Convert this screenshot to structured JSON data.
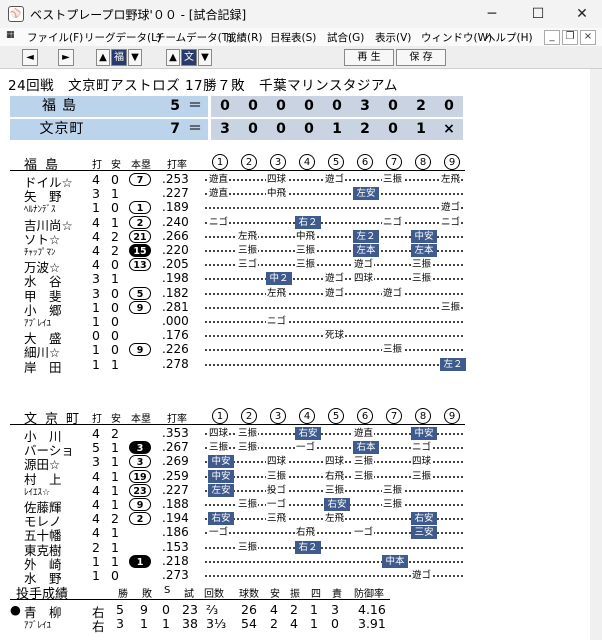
{
  "window": {
    "title": "ベストプレープロ野球'００ - [試合記録]",
    "minimize": "─",
    "maximize": "☐",
    "close": "✕"
  },
  "menu": [
    "ファイル(F)",
    "リーグデータ(L)",
    "チームデータ(T)",
    "成績(R)",
    "日程表(S)",
    "試合(G)",
    "表示(V)",
    "ウィンドウ(W)",
    "ヘルプ(H)"
  ],
  "mdi": {
    "min": "_",
    "restore": "❐",
    "close": "×"
  },
  "toolbar": {
    "prev": "◄",
    "next": "►",
    "up1": "▲",
    "fuku": "福",
    "down1": "▼",
    "up2": "▲",
    "bun": "文",
    "down2": "▼",
    "play": "再 生",
    "save": "保 存"
  },
  "game": {
    "title": "24回戦　文京町アストロズ 17勝７敗　千葉マリンスタジアム",
    "teams": [
      {
        "name": "福島",
        "runs": "5",
        "eq": "＝",
        "innings": [
          "0",
          "0",
          "0",
          "0",
          "0",
          "3",
          "0",
          "2",
          "0"
        ]
      },
      {
        "name": "文京町",
        "runs": "7",
        "eq": "＝",
        "innings": [
          "3",
          "0",
          "0",
          "0",
          "1",
          "2",
          "0",
          "1",
          "×"
        ]
      }
    ]
  },
  "headers": {
    "hits_label": "打",
    "an": "安",
    "hr": "本塁",
    "avg": "打率",
    "innings": [
      "1",
      "2",
      "3",
      "4",
      "5",
      "6",
      "7",
      "8",
      "9"
    ]
  },
  "team1": {
    "name": "福島",
    "players": [
      {
        "name": "ドイル☆",
        "ab": "4",
        "h": "0",
        "hr": "7",
        "avg": ".253",
        "r": [
          [
            "遊直",
            0,
            false
          ],
          [
            "四球",
            2,
            false
          ],
          [
            "遊ゴ",
            4,
            false
          ],
          [
            "三振",
            6,
            false
          ],
          [
            "左飛",
            8,
            false
          ]
        ]
      },
      {
        "name": "矢　野",
        "ab": "3",
        "h": "1",
        "hr": "",
        "avg": ".227",
        "r": [
          [
            "遊直",
            0,
            false
          ],
          [
            "中飛",
            2,
            false
          ],
          [
            "左安",
            5,
            true
          ]
        ]
      },
      {
        "name": "ﾍﾙﾅﾝﾃﾞｽ",
        "small": true,
        "ab": "1",
        "h": "0",
        "hr": "1",
        "avg": ".189",
        "r": [
          [
            "遊ゴ",
            8,
            false
          ]
        ]
      },
      {
        "name": "吉川尚☆",
        "ab": "4",
        "h": "1",
        "hr": "2",
        "avg": ".240",
        "r": [
          [
            "ニゴ",
            0,
            false
          ],
          [
            "右２",
            3,
            true
          ],
          [
            "ニゴ",
            6,
            false
          ],
          [
            "ニゴ",
            8,
            false
          ]
        ]
      },
      {
        "name": "ソト☆",
        "ab": "4",
        "h": "2",
        "hr": "21",
        "avg": ".266",
        "r": [
          [
            "左飛",
            1,
            false
          ],
          [
            "中飛",
            3,
            false
          ],
          [
            "左２",
            5,
            true
          ],
          [
            "中安",
            7,
            true
          ]
        ]
      },
      {
        "name": "ﾁｬｯﾌﾟﾏﾝ",
        "small": true,
        "ab": "4",
        "h": "2",
        "hr": "15",
        "fill": true,
        "avg": ".220",
        "r": [
          [
            "三振",
            1,
            false
          ],
          [
            "三振",
            3,
            false
          ],
          [
            "左本",
            5,
            true
          ],
          [
            "左本",
            7,
            true
          ]
        ]
      },
      {
        "name": "万波☆",
        "ab": "4",
        "h": "0",
        "hr": "13",
        "avg": ".205",
        "r": [
          [
            "三ゴ",
            1,
            false
          ],
          [
            "三振",
            3,
            false
          ],
          [
            "遊ゴ",
            5,
            false
          ],
          [
            "三振",
            7,
            false
          ]
        ]
      },
      {
        "name": "水　谷",
        "ab": "3",
        "h": "1",
        "hr": "",
        "avg": ".198",
        "r": [
          [
            "中２",
            2,
            true
          ],
          [
            "遊ゴ",
            4,
            false
          ],
          [
            "四球",
            5,
            false
          ],
          [
            "三振",
            7,
            false
          ]
        ]
      },
      {
        "name": "甲　斐",
        "ab": "3",
        "h": "0",
        "hr": "5",
        "avg": ".182",
        "r": [
          [
            "左飛",
            2,
            false
          ],
          [
            "遊ゴ",
            4,
            false
          ],
          [
            "遊ゴ",
            6,
            false
          ]
        ]
      },
      {
        "name": "小　郷",
        "ab": "1",
        "h": "0",
        "hr": "9",
        "avg": ".281",
        "r": [
          [
            "三振",
            8,
            false
          ]
        ]
      },
      {
        "name": "ｱﾌﾞﾚｲﾕ",
        "small": true,
        "ab": "1",
        "h": "0",
        "hr": "",
        "avg": ".000",
        "r": [
          [
            "ニゴ",
            2,
            false
          ]
        ]
      },
      {
        "name": "大　盛",
        "ab": "0",
        "h": "0",
        "hr": "",
        "avg": ".176",
        "r": [
          [
            "死球",
            4,
            false
          ]
        ]
      },
      {
        "name": "細川☆",
        "ab": "1",
        "h": "0",
        "hr": "9",
        "avg": ".226",
        "r": [
          [
            "三振",
            6,
            false
          ]
        ]
      },
      {
        "name": "岸　田",
        "ab": "1",
        "h": "1",
        "hr": "",
        "avg": ".278",
        "r": [
          [
            "左２",
            8,
            true
          ]
        ]
      }
    ]
  },
  "team2": {
    "name": "文京町",
    "players": [
      {
        "name": "小　川",
        "ab": "4",
        "h": "2",
        "hr": "",
        "avg": ".353",
        "r": [
          [
            "四球",
            0,
            false
          ],
          [
            "三振",
            1,
            false
          ],
          [
            "右安",
            3,
            true
          ],
          [
            "遊直",
            5,
            false
          ],
          [
            "中安",
            7,
            true
          ]
        ]
      },
      {
        "name": "バーショ",
        "ab": "5",
        "h": "1",
        "hr": "3",
        "fill": true,
        "avg": ".267",
        "r": [
          [
            "三振",
            0,
            false
          ],
          [
            "三振",
            1,
            false
          ],
          [
            "一ゴ",
            3,
            false
          ],
          [
            "右本",
            5,
            true
          ],
          [
            "ニゴ",
            7,
            false
          ]
        ]
      },
      {
        "name": "源田☆",
        "ab": "3",
        "h": "1",
        "hr": "3",
        "avg": ".269",
        "r": [
          [
            "中安",
            0,
            true
          ],
          [
            "四球",
            2,
            false
          ],
          [
            "四球",
            4,
            false
          ],
          [
            "三振",
            5,
            false
          ],
          [
            "四球",
            7,
            false
          ]
        ]
      },
      {
        "name": "村　上",
        "ab": "4",
        "h": "1",
        "hr": "19",
        "avg": ".259",
        "r": [
          [
            "中安",
            0,
            true
          ],
          [
            "三振",
            2,
            false
          ],
          [
            "右飛",
            4,
            false
          ],
          [
            "三振",
            5,
            false
          ],
          [
            "三振",
            7,
            false
          ]
        ]
      },
      {
        "name": "ﾚｲｴｽ☆",
        "small": true,
        "ab": "4",
        "h": "1",
        "hr": "23",
        "avg": ".227",
        "r": [
          [
            "左安",
            0,
            true
          ],
          [
            "投ゴ",
            2,
            false
          ],
          [
            "三振",
            4,
            false
          ],
          [
            "三振",
            6,
            false
          ]
        ]
      },
      {
        "name": "佐藤輝",
        "ab": "4",
        "h": "1",
        "hr": "9",
        "avg": ".188",
        "r": [
          [
            "三振",
            1,
            false
          ],
          [
            "一ゴ",
            2,
            false
          ],
          [
            "右安",
            4,
            true
          ],
          [
            "三振",
            6,
            false
          ]
        ]
      },
      {
        "name": "モレノ",
        "ab": "4",
        "h": "2",
        "hr": "2",
        "avg": ".194",
        "r": [
          [
            "右安",
            0,
            true
          ],
          [
            "三飛",
            2,
            false
          ],
          [
            "左飛",
            4,
            false
          ],
          [
            "右安",
            7,
            true
          ]
        ]
      },
      {
        "name": "五十幡",
        "ab": "4",
        "h": "1",
        "hr": "",
        "avg": ".186",
        "r": [
          [
            "一ゴ",
            0,
            false
          ],
          [
            "右飛",
            3,
            false
          ],
          [
            "一ゴ",
            5,
            false
          ],
          [
            "三安",
            7,
            true
          ]
        ]
      },
      {
        "name": "東克樹",
        "ab": "2",
        "h": "1",
        "hr": "",
        "avg": ".153",
        "r": [
          [
            "三振",
            1,
            false
          ],
          [
            "右２",
            3,
            true
          ]
        ]
      },
      {
        "name": "外　崎",
        "ab": "1",
        "h": "1",
        "hr": "1",
        "fill": true,
        "avg": ".218",
        "r": [
          [
            "中本",
            6,
            true
          ]
        ]
      },
      {
        "name": "水　野",
        "ab": "1",
        "h": "0",
        "hr": "",
        "avg": ".273",
        "r": [
          [
            "遊ゴ",
            7,
            false
          ]
        ]
      }
    ]
  },
  "pitching": {
    "title": "投手成績",
    "headers": [
      "勝",
      "敗",
      "S",
      "試",
      "回数",
      "球数",
      "安",
      "振",
      "四",
      "責",
      "防御率"
    ],
    "rows": [
      {
        "mark": "●",
        "name": "青　柳",
        "hand": "右",
        "w": "5",
        "l": "9",
        "s": "0",
        "g": "23",
        "ip": "⅔",
        "np": "26",
        "h": "4",
        "k": "2",
        "bb": "1",
        "er": "3",
        "era": "4.16"
      },
      {
        "mark": "",
        "name": "ｱﾌﾞﾚｲﾕ",
        "small": true,
        "hand": "右",
        "w": "3",
        "l": "1",
        "s": "1",
        "g": "38",
        "ip": "3⅓",
        "np": "54",
        "h": "2",
        "k": "4",
        "bb": "1",
        "er": "0",
        "era": "3.91"
      }
    ]
  }
}
